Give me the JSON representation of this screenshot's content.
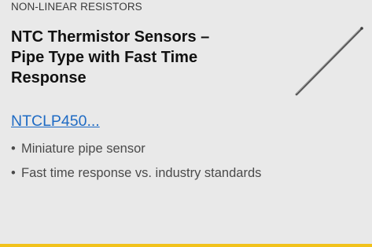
{
  "card": {
    "category": "NON-LINEAR RESISTORS",
    "title_lines": [
      "NTC Thermistor Sensors –",
      "Pipe Type with Fast Time",
      "Response"
    ],
    "part_link": "NTCLP450...",
    "features": [
      "Miniature pipe sensor",
      "Fast time response vs. industry standards"
    ],
    "image": "thermistor-pipe-sensor-photo",
    "accent_color": "#f2c21b",
    "link_color": "#1f6bc4",
    "background_color": "#e9e9e9",
    "bullet_glyph": "•"
  }
}
